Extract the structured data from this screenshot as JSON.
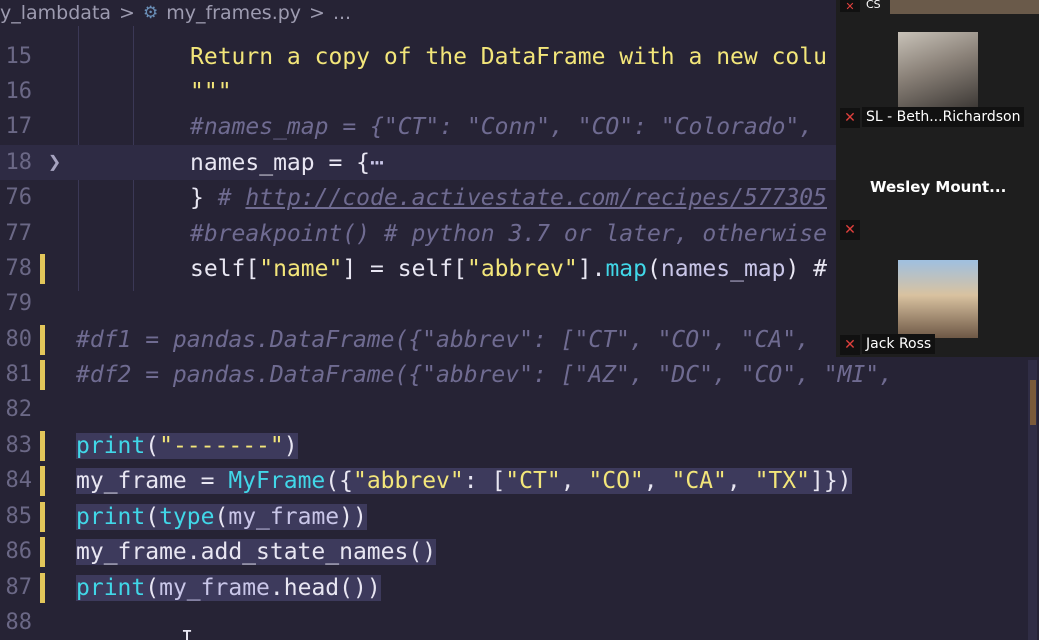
{
  "breadcrumb": {
    "folder": "y_lambdata",
    "sep1": ">",
    "file": "my_frames.py",
    "sep2": ">",
    "more": "..."
  },
  "lines": {
    "l15": {
      "num": "15",
      "text": "Return a copy of the DataFrame with a new colu"
    },
    "l16": {
      "num": "16",
      "text": "\"\"\""
    },
    "l17": {
      "num": "17",
      "text": "#names_map = {\"CT\": \"Conn\", \"CO\": \"Colorado\","
    },
    "l18": {
      "num": "18",
      "p1": "names_map = {",
      "p2": "⋯"
    },
    "l76": {
      "num": "76",
      "p1": "} ",
      "p2": "# ",
      "p3": "http://code.activestate.com/recipes/577305"
    },
    "l77": {
      "num": "77",
      "text": "#breakpoint() # python 3.7 or later, otherwise"
    },
    "l78": {
      "num": "78",
      "p1": "self[",
      "p2": "\"name\"",
      "p3": "] = self[",
      "p4": "\"abbrev\"",
      "p5": "].",
      "p6": "map",
      "p7": "(",
      "p8": "names_map",
      "p9": ") #"
    },
    "l79": {
      "num": "79"
    },
    "l80": {
      "num": "80",
      "text": "#df1 = pandas.DataFrame({\"abbrev\": [\"CT\", \"CO\", \"CA\","
    },
    "l81": {
      "num": "81",
      "text": "#df2 = pandas.DataFrame({\"abbrev\": [\"AZ\", \"DC\", \"CO\", \"MI\","
    },
    "l82": {
      "num": "82"
    },
    "l83": {
      "num": "83",
      "p1": "print",
      "p2": "(",
      "p3": "\"-------\"",
      "p4": ")"
    },
    "l84": {
      "num": "84",
      "p1": "my_frame = ",
      "p2": "MyFrame",
      "p3": "({",
      "p4": "\"abbrev\"",
      "p5": ": [",
      "p6": "\"CT\"",
      "p7": ", ",
      "p8": "\"CO\"",
      "p9": ", ",
      "p10": "\"CA\"",
      "p11": ", ",
      "p12": "\"TX\"",
      "p13": "]})"
    },
    "l85": {
      "num": "85",
      "p1": "print",
      "p2": "(",
      "p3": "type",
      "p4": "(",
      "p5": "my_frame",
      "p6": "))"
    },
    "l86": {
      "num": "86",
      "p1": "my_frame.",
      "p2": "add_state_names",
      "p3": "()"
    },
    "l87": {
      "num": "87",
      "p1": "print",
      "p2": "(",
      "p3": "my_frame",
      "p4": ".",
      "p5": "head",
      "p6": "())"
    },
    "l88": {
      "num": "88"
    }
  },
  "participants": {
    "top_label": "CS",
    "p1": {
      "name": "SL - Beth...Richardson",
      "mic_icon": "mic-muted-icon"
    },
    "p2": {
      "name": "Wesley Mount...",
      "mic_icon": "mic-muted-icon"
    },
    "p3": {
      "name": "Jack Ross",
      "mic_icon": "mic-muted-icon"
    }
  },
  "colors": {
    "editor_bg": "#262335",
    "string": "#f3e67a",
    "function": "#41d7e8",
    "comment": "#6f6b91",
    "modified_gutter": "#e2c65a",
    "mic_muted": "#e0403d"
  }
}
